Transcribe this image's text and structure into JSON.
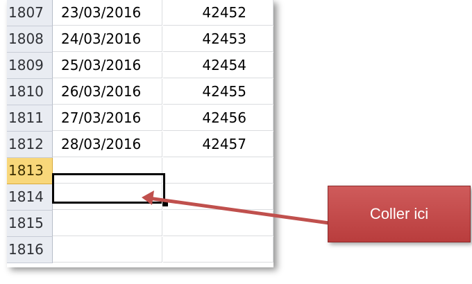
{
  "rows": [
    {
      "num": "1807",
      "date": "23/03/2016",
      "value": "42452"
    },
    {
      "num": "1808",
      "date": "24/03/2016",
      "value": "42453"
    },
    {
      "num": "1809",
      "date": "25/03/2016",
      "value": "42454"
    },
    {
      "num": "1810",
      "date": "26/03/2016",
      "value": "42455"
    },
    {
      "num": "1811",
      "date": "27/03/2016",
      "value": "42456"
    },
    {
      "num": "1812",
      "date": "28/03/2016",
      "value": "42457"
    },
    {
      "num": "1813",
      "date": "",
      "value": ""
    },
    {
      "num": "1814",
      "date": "",
      "value": ""
    },
    {
      "num": "1815",
      "date": "",
      "value": ""
    },
    {
      "num": "1816",
      "date": "",
      "value": ""
    }
  ],
  "active_row": "1813",
  "callout": {
    "label": "Coller ici"
  },
  "colors": {
    "active_row_header": "#f8d77a",
    "row_header": "#e9ecf2",
    "callout_fill": "#c0504d",
    "arrow": "#c0504d"
  }
}
